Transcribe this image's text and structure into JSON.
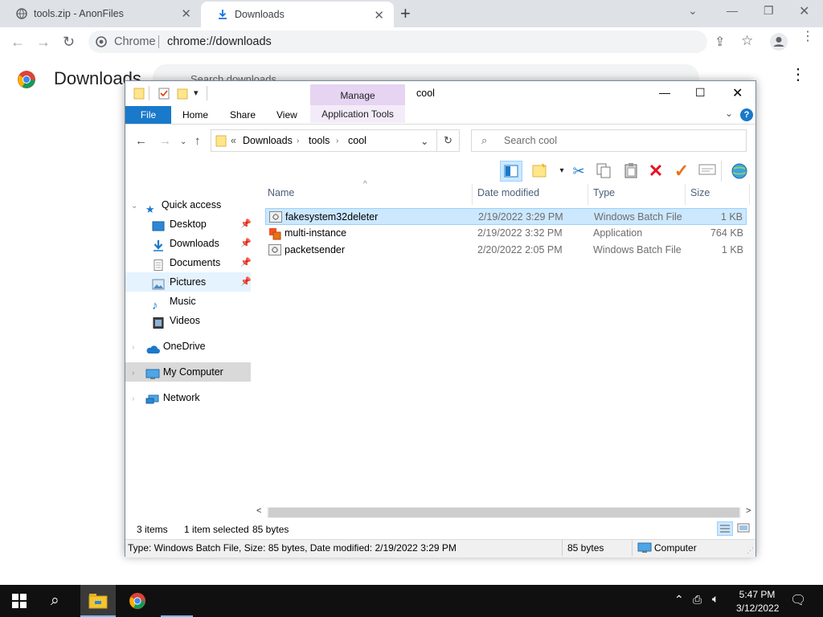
{
  "browser": {
    "tabs": [
      {
        "label": "tools.zip - AnonFiles",
        "active": false
      },
      {
        "label": "Downloads",
        "active": true
      }
    ],
    "omnibox": {
      "site": "Chrome",
      "url": "chrome://downloads"
    }
  },
  "page": {
    "title": "Downloads",
    "search_placeholder": "Search downloads"
  },
  "explorer": {
    "title": "cool",
    "ribbon": {
      "context_group": "Manage",
      "context_tab": "Application Tools",
      "tabs": [
        "File",
        "Home",
        "Share",
        "View"
      ]
    },
    "breadcrumb": {
      "prefix": "«",
      "parts": [
        "Downloads",
        "tools",
        "cool"
      ]
    },
    "search_placeholder": "Search cool",
    "nav": {
      "quick_access": "Quick access",
      "quick_items": [
        "Desktop",
        "Downloads",
        "Documents",
        "Pictures",
        "Music",
        "Videos"
      ],
      "onedrive": "OneDrive",
      "mycomputer": "My Computer",
      "network": "Network"
    },
    "columns": {
      "name": "Name",
      "date": "Date modified",
      "type": "Type",
      "size": "Size"
    },
    "files": [
      {
        "name": "fakesystem32deleter",
        "date": "2/19/2022 3:29 PM",
        "type": "Windows Batch File",
        "size": "1 KB",
        "icon": "batch-file-icon",
        "selected": true
      },
      {
        "name": "multi-instance",
        "date": "2/19/2022 3:32 PM",
        "type": "Application",
        "size": "764 KB",
        "icon": "application-icon",
        "selected": false
      },
      {
        "name": "packetsender",
        "date": "2/20/2022 2:05 PM",
        "type": "Windows Batch File",
        "size": "1 KB",
        "icon": "batch-file-icon",
        "selected": false
      }
    ],
    "status": {
      "items": "3 items",
      "selected": "1 item selected",
      "bytes": "85 bytes"
    },
    "details_bar": {
      "text": "Type: Windows Batch File, Size: 85 bytes, Date modified: 2/19/2022 3:29 PM",
      "size": "85 bytes",
      "location": "Computer"
    }
  },
  "taskbar": {
    "time": "5:47 PM",
    "date": "3/12/2022"
  },
  "colors": {
    "file_tab": "#1979ca",
    "manage_tab": "#e6d4f2",
    "selection": "#cce8ff"
  }
}
